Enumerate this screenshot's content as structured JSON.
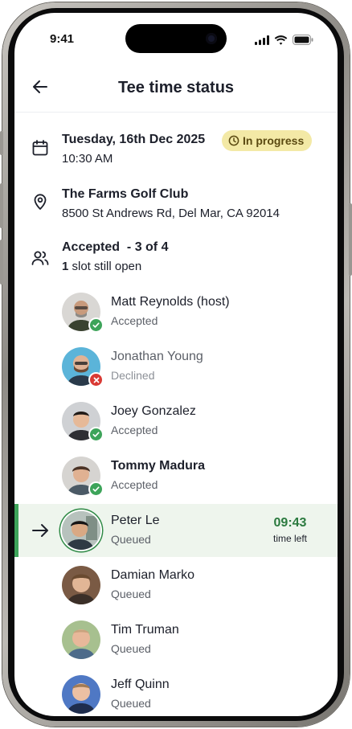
{
  "status_bar": {
    "time": "9:41"
  },
  "header": {
    "title": "Tee time status"
  },
  "date_row": {
    "date": "Tuesday, 16th Dec 2025",
    "time": "10:30 AM",
    "badge": "In progress",
    "badge_color": "#f3e9a6"
  },
  "location_row": {
    "name": "The Farms Golf Club",
    "address": "8500 St Andrews Rd, Del Mar, CA 92014"
  },
  "accepted_row": {
    "summary": "Accepted  - 3 of 4",
    "slots_count": "1",
    "slots_text": " slot still open"
  },
  "players": [
    {
      "name": "Matt Reynolds (host)",
      "status": "Accepted",
      "state": "accepted"
    },
    {
      "name": "Jonathan Young",
      "status": "Declined",
      "state": "declined"
    },
    {
      "name": "Joey Gonzalez",
      "status": "Accepted",
      "state": "accepted"
    },
    {
      "name": "Tommy Madura",
      "status": "Accepted",
      "state": "accepted"
    },
    {
      "name": "Peter Le",
      "status": "Queued",
      "state": "active",
      "timer": "09:43",
      "timer_label": "time left"
    },
    {
      "name": "Damian Marko",
      "status": "Queued",
      "state": "queued"
    },
    {
      "name": "Tim Truman",
      "status": "Queued",
      "state": "queued"
    },
    {
      "name": "Jeff Quinn",
      "status": "Queued",
      "state": "queued"
    }
  ],
  "colors": {
    "accent_green": "#3da45a",
    "timer_green": "#2b7a3f",
    "declined_red": "#d93a34",
    "active_row_bg": "#eef5ed"
  }
}
